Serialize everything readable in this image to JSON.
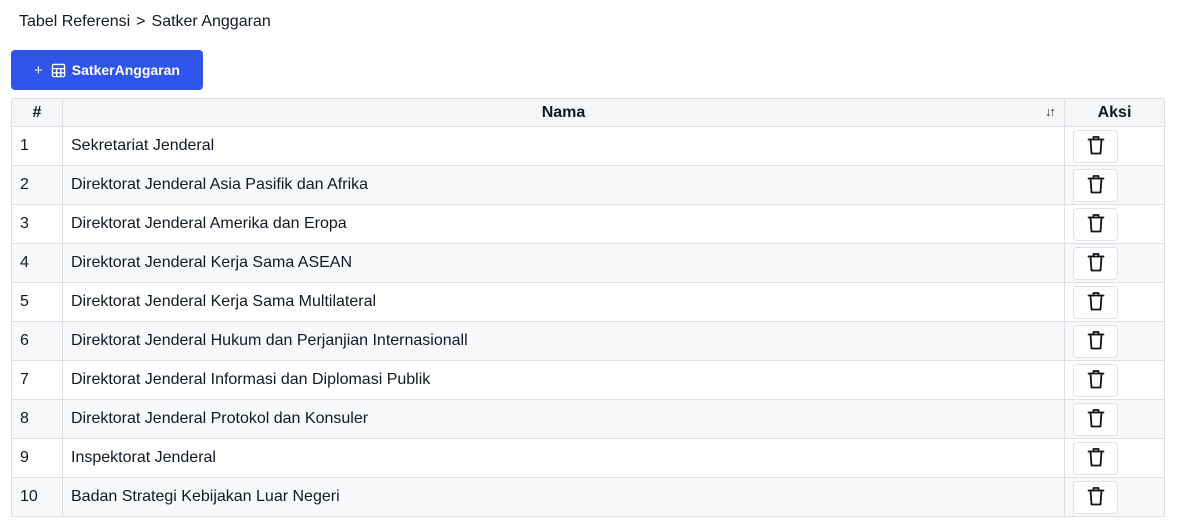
{
  "breadcrumb": {
    "parent": "Tabel Referensi",
    "separator": ">",
    "current": "Satker Anggaran"
  },
  "toolbar": {
    "add_plus": "+",
    "add_label": "SatkerAnggaran",
    "add_icon": "table-icon",
    "accent": "#2f54eb"
  },
  "table": {
    "headers": {
      "no": "#",
      "nama": "Nama",
      "aksi": "Aksi",
      "sort_icon": "sort-icon"
    },
    "rows": [
      {
        "no": "1",
        "nama": "Sekretariat Jenderal"
      },
      {
        "no": "2",
        "nama": "Direktorat Jenderal Asia Pasifik dan Afrika"
      },
      {
        "no": "3",
        "nama": "Direktorat Jenderal Amerika dan Eropa"
      },
      {
        "no": "4",
        "nama": "Direktorat Jenderal Kerja Sama ASEAN"
      },
      {
        "no": "5",
        "nama": "Direktorat Jenderal Kerja Sama Multilateral"
      },
      {
        "no": "6",
        "nama": "Direktorat Jenderal Hukum dan Perjanjian Internasionall"
      },
      {
        "no": "7",
        "nama": "Direktorat Jenderal Informasi dan Diplomasi Publik"
      },
      {
        "no": "8",
        "nama": "Direktorat Jenderal Protokol dan Konsuler"
      },
      {
        "no": "9",
        "nama": "Inspektorat Jenderal"
      },
      {
        "no": "10",
        "nama": "Badan Strategi Kebijakan Luar Negeri"
      }
    ],
    "row_action_icon": "trash-icon"
  }
}
